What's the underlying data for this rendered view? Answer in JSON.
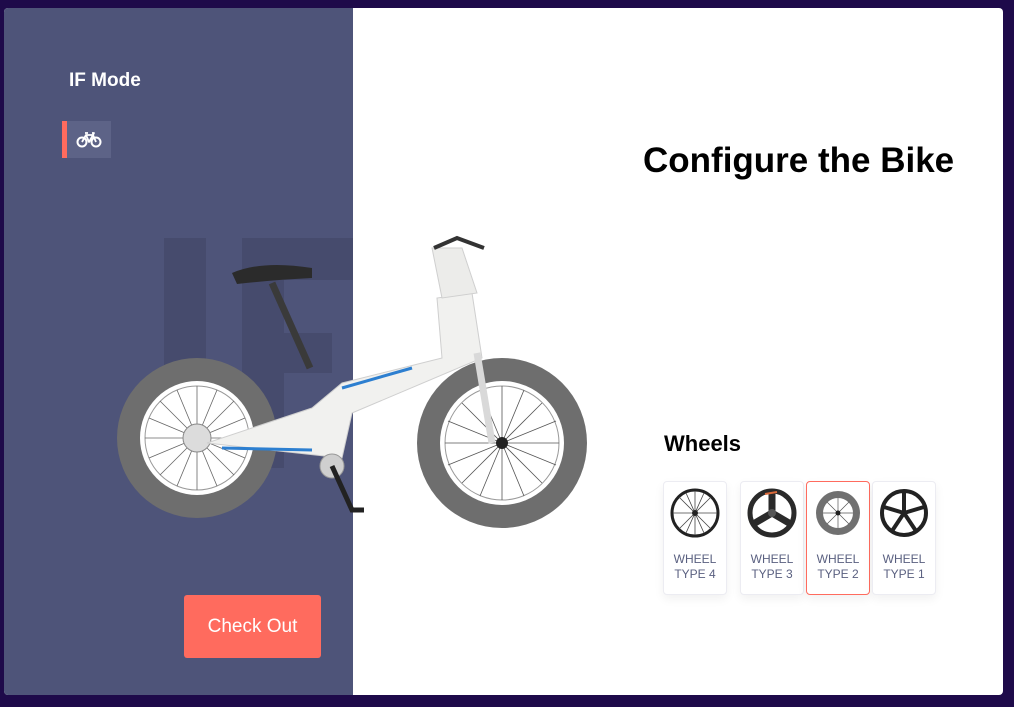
{
  "sidebar": {
    "title": "IF Mode",
    "mode_icon": "bicycle-icon",
    "watermark": "IF"
  },
  "main": {
    "title": "Configure the Bike"
  },
  "wheels": {
    "title": "Wheels",
    "options": [
      {
        "line1": "WHEEL",
        "line2": "TYPE 4",
        "icon": "spoked-wheel-icon",
        "selected": false
      },
      {
        "line1": "WHEEL",
        "line2": "TYPE 3",
        "icon": "tri-spoke-wheel-icon",
        "selected": false
      },
      {
        "line1": "WHEEL",
        "line2": "TYPE 2",
        "icon": "deep-rim-wheel-icon",
        "selected": true
      },
      {
        "line1": "WHEEL",
        "line2": "TYPE 1",
        "icon": "five-spoke-wheel-icon",
        "selected": false
      }
    ]
  },
  "checkout": {
    "label": "Check Out"
  },
  "colors": {
    "accent": "#ff6b5e",
    "sidebar_bg": "#4e5479",
    "page_bg": "#1e0a4a"
  }
}
